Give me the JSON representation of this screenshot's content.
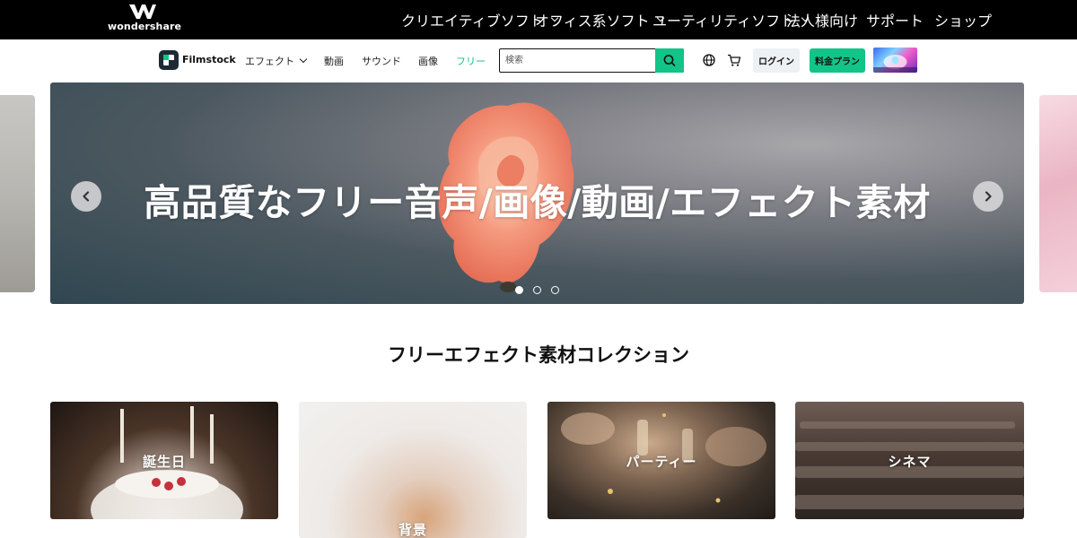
{
  "topbar": {
    "brand": "wondershare",
    "nav": [
      {
        "label": "クリエイティブソフト",
        "dropdown": true
      },
      {
        "label": "オフィス系ソフト",
        "dropdown": true
      },
      {
        "label": "ユーティリティソフト",
        "dropdown": true
      },
      {
        "label": "法人様向け",
        "dropdown": false
      },
      {
        "label": "サポート",
        "dropdown": false
      },
      {
        "label": "ショップ",
        "dropdown": false
      }
    ]
  },
  "subnav": {
    "brand": "Filmstock",
    "items": [
      "エフェクト",
      "動画",
      "サウンド",
      "画像",
      "フリー"
    ],
    "search_placeholder": "検索",
    "login_label": "ログイン",
    "pricing_label": "料金プラン"
  },
  "hero": {
    "title": "高品質なフリー音声/画像/動画/エフェクト素材",
    "prev_icon": "chevron-left-icon",
    "next_icon": "chevron-right-icon",
    "slide_count": 3,
    "active_slide": 1
  },
  "section": {
    "title": "フリーエフェクト素材コレクション",
    "cards": [
      {
        "label": "誕生日"
      },
      {
        "label": "背景"
      },
      {
        "label": "パーティー"
      },
      {
        "label": "シネマ"
      }
    ]
  },
  "colors": {
    "accent": "#12c488",
    "topbar_bg": "#000000",
    "text": "#111111"
  }
}
